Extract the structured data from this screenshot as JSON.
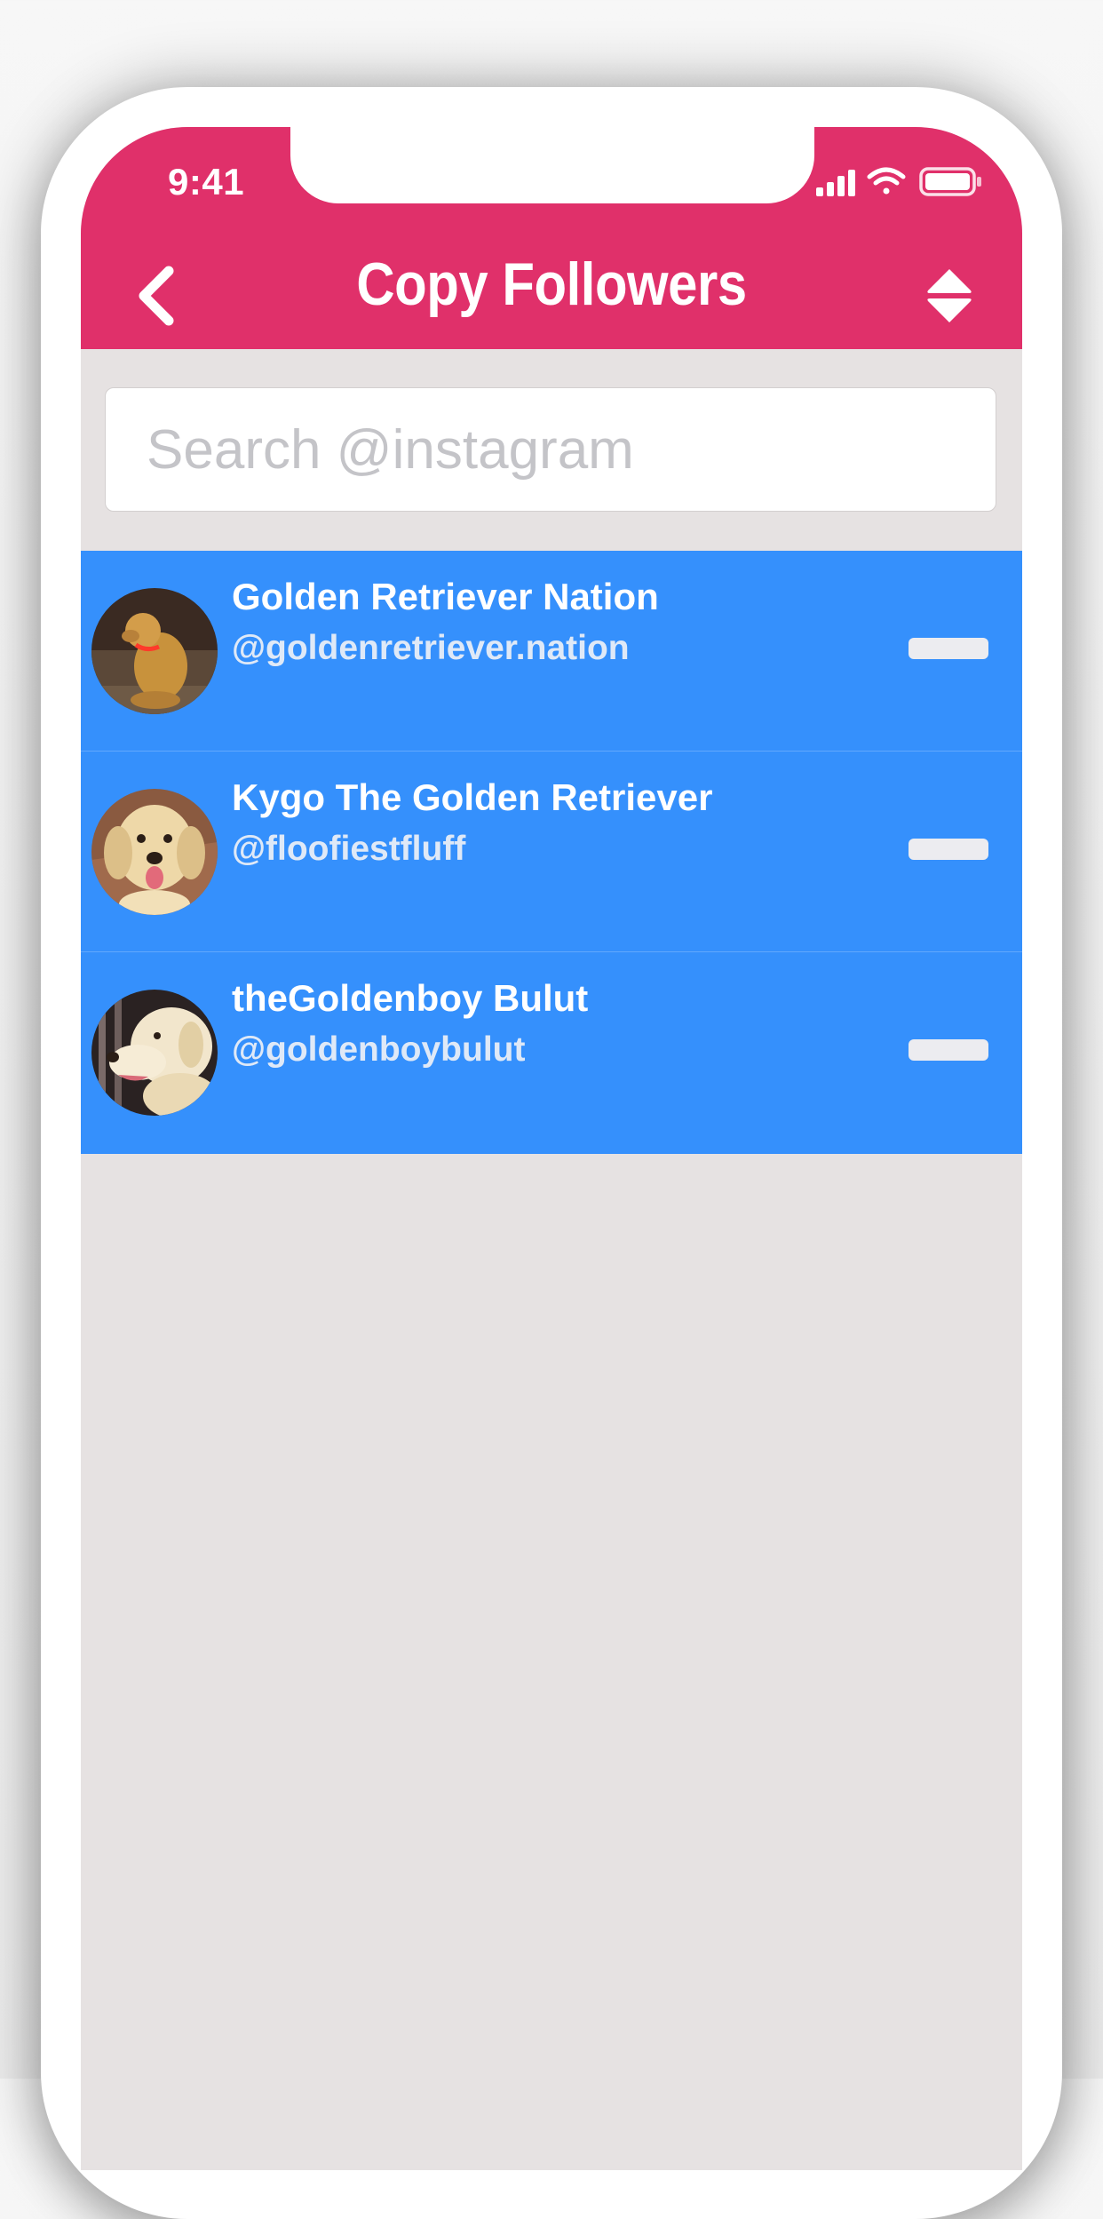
{
  "status_bar": {
    "time": "9:41",
    "icons": [
      "signal-icon",
      "wifi-icon",
      "battery-icon"
    ]
  },
  "header": {
    "title": "Copy Followers",
    "back_icon": "chevron-left-icon",
    "sort_icon": "sort-up-down-icon"
  },
  "search": {
    "placeholder": "Search @instagram",
    "value": ""
  },
  "accounts": [
    {
      "name": "Golden Retriever Nation",
      "handle": "@goldenretriever.nation",
      "avatar": "golden-retriever-sitting-photo"
    },
    {
      "name": "Kygo The Golden Retriever",
      "handle": "@floofiestfluff",
      "avatar": "golden-retriever-smiling-photo"
    },
    {
      "name": "theGoldenboy Bulut",
      "handle": "@goldenboybulut",
      "avatar": "golden-retriever-profile-photo"
    }
  ],
  "colors": {
    "header": "#e0306a",
    "row": "#3590fc",
    "background": "#e6e2e2"
  }
}
